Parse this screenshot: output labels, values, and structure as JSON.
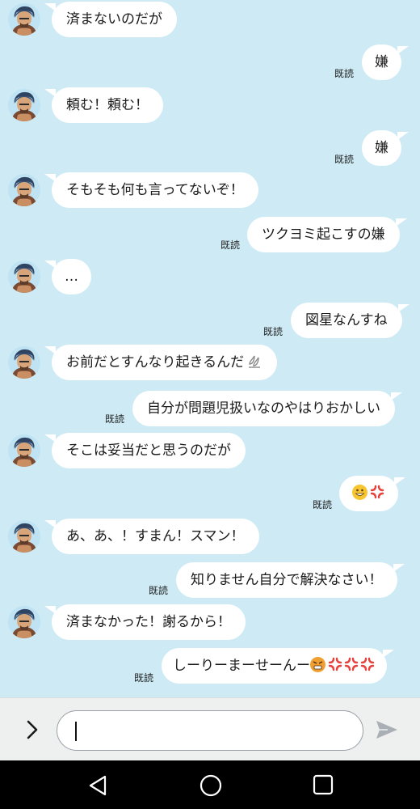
{
  "read_label": "既読",
  "messages": {
    "m1": "済まないのだが",
    "m2": "嫌",
    "m3": "頼む！頼む！",
    "m4": "嫌",
    "m5": "そもそも何も言ってないぞ！",
    "m6": "ツクヨミ起こすの嫌",
    "m7": "…",
    "m8": "図星なんすね",
    "m9": "お前だとすんなり起きるんだ",
    "m10": "自分が問題児扱いなのやはりおかしい",
    "m11": "そこは妥当だと思うのだが",
    "m12": "",
    "m13": "あ、あ、！すまん！スマン！",
    "m14": "知りません自分で解決なさい！",
    "m15": "済まなかった！謝るから！",
    "m16": "しーりーまーせーんー"
  },
  "icons": [
    "avatar",
    "sweat-droplets-icon",
    "grinning-face-icon",
    "anger-symbol-icon",
    "angry-face-icon",
    "chevron-right-icon",
    "send-icon",
    "nav-back-icon",
    "nav-home-icon",
    "nav-recent-icon"
  ],
  "colors": {
    "chat_bg": "#cdeaf5",
    "bubble": "#ffffff",
    "input_bar": "#eef0f0",
    "nav_bar": "#000000",
    "anger": "#e8413c"
  }
}
